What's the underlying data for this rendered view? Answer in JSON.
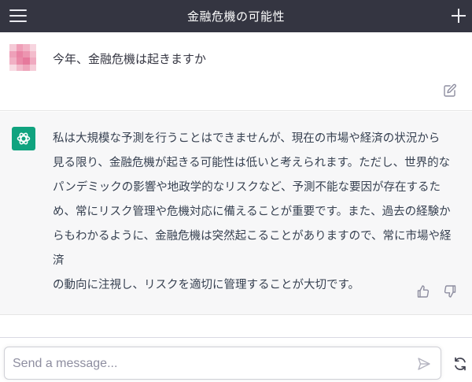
{
  "header": {
    "title": "金融危機の可能性",
    "menu_icon": "hamburger-menu-icon",
    "new_chat_icon": "plus-icon"
  },
  "conversation": {
    "user_message": {
      "avatar": "pixelated-user-avatar",
      "text": "今年、金融危機は起きますか",
      "edit_icon": "edit-icon"
    },
    "assistant_message": {
      "avatar": "openai-logo-icon",
      "lines": [
        "私は大規模な予測を行うことはできませんが、現在の市場や経済の状況から",
        "見る限り、金融危機が起きる可能性は低いと考えられます。ただし、世界的な",
        "パンデミックの影響や地政学的なリスクなど、予測不能な要因が存在するた",
        "め、常にリスク管理や危機対応に備えることが重要です。また、過去の経験か",
        "らもわかるように、金融危機は突然起こることがありますので、常に市場や経済",
        "の動向に注視し、リスクを適切に管理することが大切です。"
      ],
      "thumbs_up_icon": "thumbs-up-icon",
      "thumbs_down_icon": "thumbs-down-icon"
    }
  },
  "composer": {
    "placeholder": "Send a message...",
    "value": "",
    "send_icon": "send-icon",
    "regenerate_icon": "regenerate-icon"
  },
  "colors": {
    "header_bg": "#343541",
    "assistant_bg": "#f7f7f8",
    "accent": "#10a37f"
  }
}
